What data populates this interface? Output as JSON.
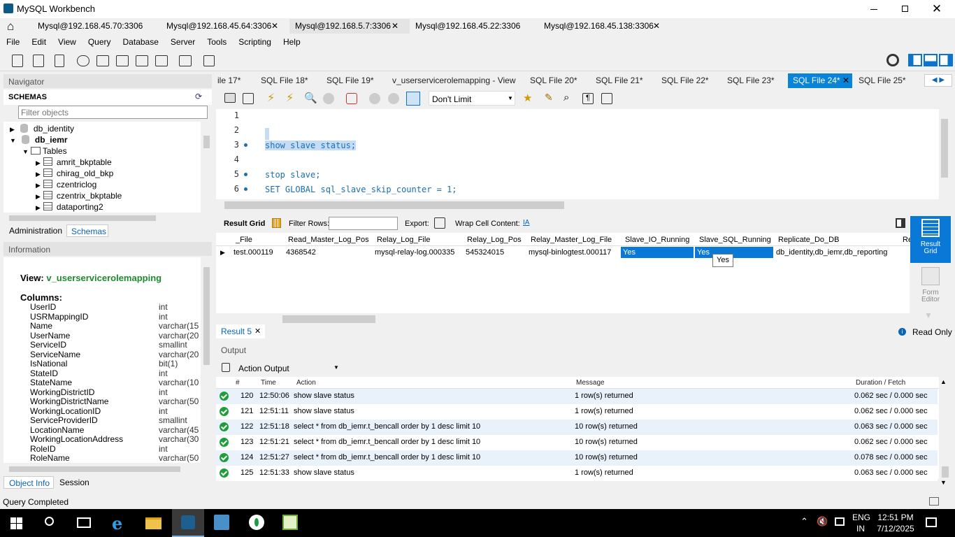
{
  "window": {
    "title": "MySQL Workbench"
  },
  "connection_tabs": [
    "Mysql@192.168.45.70:3306",
    "Mysql@192.168.45.64:3306",
    "Mysql@192.168.5.7:3306",
    "Mysql@192.168.45.22:3306",
    "Mysql@192.168.45.138:3306"
  ],
  "menu": [
    "File",
    "Edit",
    "View",
    "Query",
    "Database",
    "Server",
    "Tools",
    "Scripting",
    "Help"
  ],
  "navigator": {
    "title": "Navigator",
    "schemas_label": "SCHEMAS",
    "filter_placeholder": "Filter objects",
    "tree": [
      "db_identity",
      "db_iemr",
      "Tables",
      "amrit_bkptable",
      "chirag_old_bkp",
      "czentriclog",
      "czentrix_bkptable",
      "dataporting2"
    ],
    "tabs": [
      "Administration",
      "Schemas"
    ]
  },
  "information": {
    "title": "Information",
    "view_label": "View:",
    "view_name": "v_userservicerolemapping",
    "columns_label": "Columns:",
    "columns": [
      {
        "name": "UserID",
        "type": "int"
      },
      {
        "name": "USRMappingID",
        "type": "int"
      },
      {
        "name": "Name",
        "type": "varchar(15"
      },
      {
        "name": "UserName",
        "type": "varchar(20"
      },
      {
        "name": "ServiceID",
        "type": "smallint"
      },
      {
        "name": "ServiceName",
        "type": "varchar(20"
      },
      {
        "name": "IsNational",
        "type": "bit(1)"
      },
      {
        "name": "StateID",
        "type": "int"
      },
      {
        "name": "StateName",
        "type": "varchar(10"
      },
      {
        "name": "WorkingDistrictID",
        "type": "int"
      },
      {
        "name": "WorkingDistrictName",
        "type": "varchar(50"
      },
      {
        "name": "WorkingLocationID",
        "type": "int"
      },
      {
        "name": "ServiceProviderID",
        "type": "smallint"
      },
      {
        "name": "LocationName",
        "type": "varchar(45"
      },
      {
        "name": "WorkingLocationAddress",
        "type": "varchar(30"
      },
      {
        "name": "RoleID",
        "type": "int"
      },
      {
        "name": "RoleName",
        "type": "varchar(50"
      }
    ],
    "tabs": [
      "Object Info",
      "Session"
    ]
  },
  "sql_tabs": [
    "ile 17*",
    "SQL File 18*",
    "SQL File 19*",
    "v_userservicerolemapping - View",
    "SQL File 20*",
    "SQL File 21*",
    "SQL File 22*",
    "SQL File 23*",
    "SQL File 24*",
    "SQL File 25*"
  ],
  "editor": {
    "limit": "Don't Limit",
    "lines": [
      {
        "n": "1",
        "text": ""
      },
      {
        "n": "2",
        "text": ""
      },
      {
        "n": "3",
        "text": "show slave status;"
      },
      {
        "n": "4",
        "text": ""
      },
      {
        "n": "5",
        "text": "stop slave;"
      },
      {
        "n": "6",
        "text": "SET GLOBAL sql_slave_skip_counter = 1;"
      }
    ]
  },
  "result": {
    "result_grid_label": "Result Grid",
    "filter_rows_label": "Filter Rows:",
    "export_label": "Export:",
    "wrap_label": "Wrap Cell Content:",
    "headers": [
      "_File",
      "Read_Master_Log_Pos",
      "Relay_Log_File",
      "Relay_Log_Pos",
      "Relay_Master_Log_File",
      "Slave_IO_Running",
      "Slave_SQL_Running",
      "Replicate_Do_DB",
      "Re"
    ],
    "row": [
      "test.000119",
      "4368542",
      "mysql-relay-log.000335",
      "545324015",
      "mysql-binlogtest.000117",
      "Yes",
      "Yes",
      "db_identity,db_iemr,db_reporting"
    ],
    "tooltip": "Yes",
    "side_result_grid": "Result Grid",
    "side_form_editor": "Form Editor",
    "tab_label": "Result 5",
    "read_only": "Read Only"
  },
  "output": {
    "title": "Output",
    "dropdown": "Action Output",
    "headers": [
      "#",
      "Time",
      "Action",
      "Message",
      "Duration / Fetch"
    ],
    "rows": [
      {
        "n": "120",
        "time": "12:50:06",
        "action": "show slave status",
        "message": "1 row(s) returned",
        "duration": "0.062 sec / 0.000 sec"
      },
      {
        "n": "121",
        "time": "12:51:11",
        "action": "show slave status",
        "message": "1 row(s) returned",
        "duration": "0.062 sec / 0.000 sec"
      },
      {
        "n": "122",
        "time": "12:51:18",
        "action": "select * from db_iemr.t_bencall order by 1 desc limit 10",
        "message": "10 row(s) returned",
        "duration": "0.063 sec / 0.000 sec"
      },
      {
        "n": "123",
        "time": "12:51:21",
        "action": "select * from db_iemr.t_bencall order by 1 desc limit 10",
        "message": "10 row(s) returned",
        "duration": "0.062 sec / 0.000 sec"
      },
      {
        "n": "124",
        "time": "12:51:27",
        "action": "select * from db_iemr.t_bencall order by 1 desc limit 10",
        "message": "10 row(s) returned",
        "duration": "0.078 sec / 0.000 sec"
      },
      {
        "n": "125",
        "time": "12:51:33",
        "action": "show slave status",
        "message": "1 row(s) returned",
        "duration": "0.063 sec / 0.000 sec"
      }
    ]
  },
  "status": {
    "text": "Query Completed"
  },
  "taskbar": {
    "lang1": "ENG",
    "lang2": "IN",
    "time": "12:51 PM",
    "date": "7/12/2025"
  },
  "colors": {
    "accent": "#0078d7",
    "selection": "#c5dcf5",
    "keyword": "#1a6fb3",
    "active_tab": "#0a84d8",
    "green": "#1e9e3a"
  }
}
